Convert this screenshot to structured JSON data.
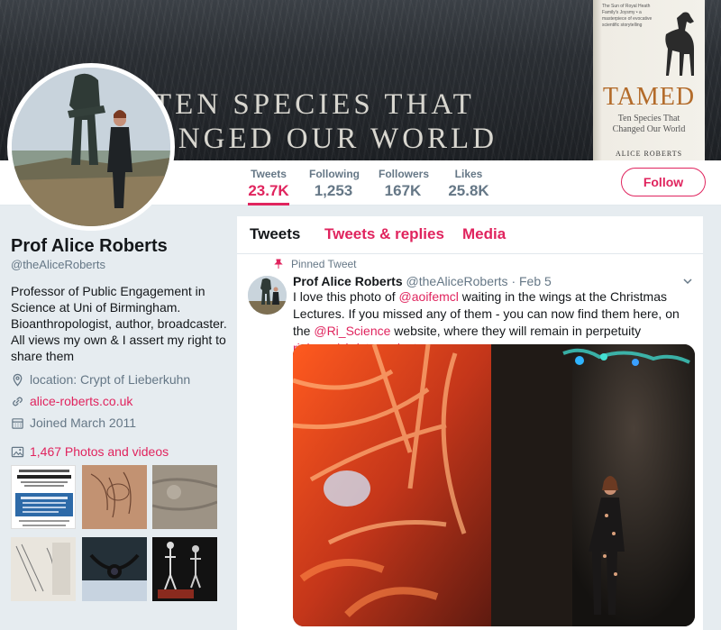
{
  "banner": {
    "tagline_line1": "TEN SPECIES THAT",
    "tagline_line2": "ANGED OUR WORLD",
    "book_blurb": "The Sun of Royal Heath Family's Joysmy • a masterpiece of evocative scientific storytelling",
    "book_title": "TAMED",
    "book_subtitle": "Ten Species That Changed Our World",
    "book_author": "ALICE ROBERTS"
  },
  "nav": {
    "stats": [
      {
        "label": "Tweets",
        "value": "23.7K",
        "active": true
      },
      {
        "label": "Following",
        "value": "1,253"
      },
      {
        "label": "Followers",
        "value": "167K"
      },
      {
        "label": "Likes",
        "value": "25.8K"
      }
    ],
    "follow_label": "Follow"
  },
  "profile": {
    "name": "Prof Alice Roberts",
    "handle": "@theAliceRoberts",
    "bio": "Professor of Public Engagement in Science at Uni of Birmingham. Bioanthropologist, author, broadcaster. All views my own & I assert my right to share them",
    "location": "location: Crypt of Lieberkuhn",
    "website": "alice-roberts.co.uk",
    "joined": "Joined March 2011",
    "photos_label": "1,467 Photos and videos",
    "thumb_poster_text": "WANTED FOR MAJOR FEATURE FILM • AMMONITE • FILMING IN DORSET MARCH 2019!"
  },
  "timeline": {
    "tabs": [
      "Tweets",
      "Tweets & replies",
      "Media"
    ],
    "pinned_label": "Pinned Tweet",
    "tweet": {
      "name": "Prof Alice Roberts",
      "handle": "@theAliceRoberts",
      "date": "· Feb 5",
      "text_1": "I love this photo of ",
      "mention_1": "@aoifemcl",
      "text_2": " waiting in the wings at the Christmas Lectures. If you missed any of them - you can now find them here, on the ",
      "mention_2": "@Ri_Science",
      "text_3": " website, where they will remain in perpetuity ",
      "link": "rigb.org/christmas-lect…"
    }
  },
  "colors": {
    "accent": "#e0245e",
    "muted": "#657786",
    "bg": "#e6ecf0"
  }
}
